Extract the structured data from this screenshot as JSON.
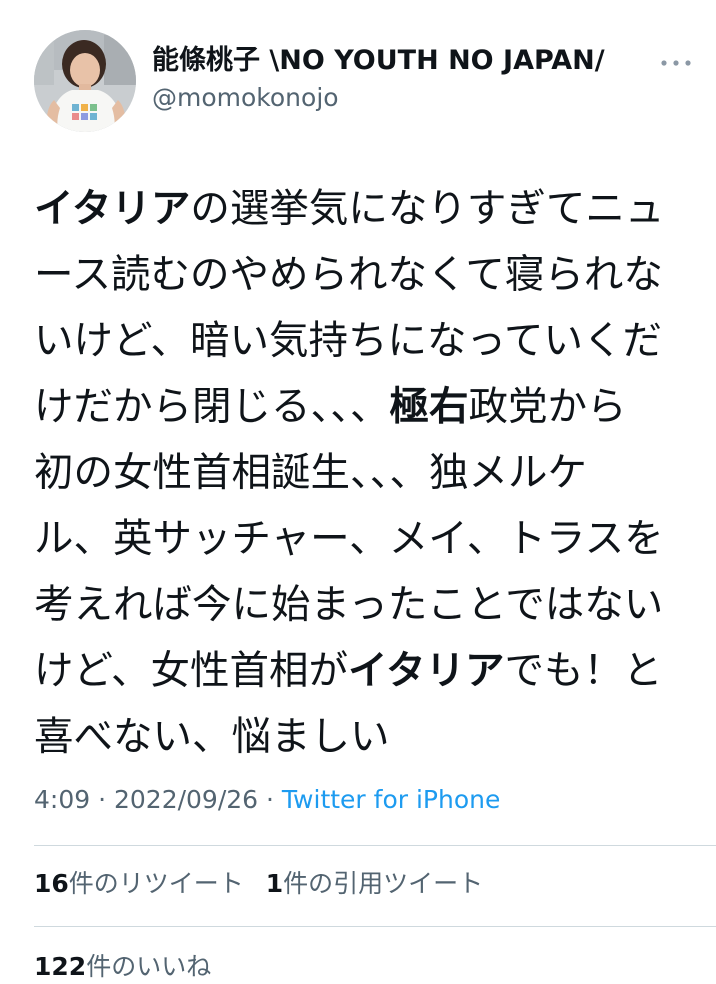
{
  "user": {
    "display_name": "能條桃子 \\NO YOUTH NO JAPAN/",
    "handle": "@momokonojo"
  },
  "tweet": {
    "lines": [
      [
        {
          "t": "イタリア",
          "b": true
        },
        {
          "t": "の選挙気になりすぎてニュ",
          "b": false
        }
      ],
      [
        {
          "t": "ース読むのやめられなくて寝られな",
          "b": false
        }
      ],
      [
        {
          "t": "いけど、暗い気持ちになっていくだ",
          "b": false
        }
      ],
      [
        {
          "t": "けだから閉じる、、、",
          "b": false
        },
        {
          "t": "極右",
          "b": true
        },
        {
          "t": "政党から",
          "b": false
        }
      ],
      [
        {
          "t": "初の女性首相誕生、、、独メルケ",
          "b": false
        }
      ],
      [
        {
          "t": "ル、英サッチャー、メイ、トラスを",
          "b": false
        }
      ],
      [
        {
          "t": "考えれば今に始まったことではない",
          "b": false
        }
      ],
      [
        {
          "t": "けど、女性首相が",
          "b": false
        },
        {
          "t": "イタリア",
          "b": true
        },
        {
          "t": "でも！と",
          "b": false
        }
      ],
      [
        {
          "t": "喜べない、悩ましい",
          "b": false
        }
      ]
    ]
  },
  "meta": {
    "time": "4:09",
    "separator": " · ",
    "date": "2022/09/26",
    "source": "Twitter for iPhone"
  },
  "stats": {
    "retweets_count": "16",
    "retweets_label": "件のリツイート",
    "quotes_count": "1",
    "quotes_label": "件の引用ツイート",
    "likes_count": "122",
    "likes_label": "件のいいね"
  },
  "colors": {
    "text_primary": "#0f1419",
    "text_secondary": "#536471",
    "link": "#1d9bf0",
    "divider": "#cfd9de"
  },
  "icons": {
    "more": "more-horizontal-icon",
    "avatar": "avatar"
  }
}
